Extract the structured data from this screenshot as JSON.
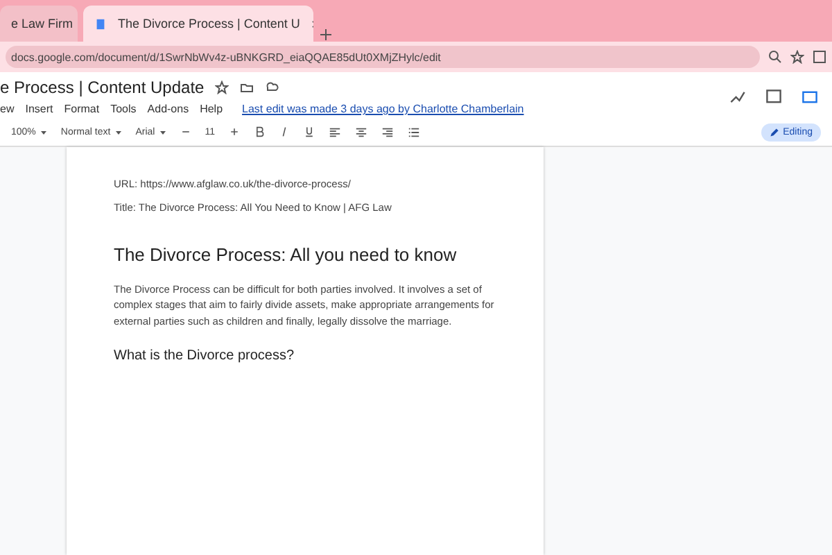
{
  "browser": {
    "tabs": [
      {
        "title": "e Law Firm",
        "selected": false
      },
      {
        "title": "The Divorce Process | Content U",
        "selected": true
      }
    ],
    "address": "docs.google.com/document/d/1SwrNbWv4z-uBNKGRD_eiaQQAE85dUt0XMjZHylc/edit"
  },
  "document_header": {
    "title": "e Process | Content Update",
    "menu": [
      "ew",
      "Insert",
      "Format",
      "Tools",
      "Add-ons",
      "Help"
    ],
    "last_edit": "Last edit was made 3 days ago by Charlotte Chamberlain"
  },
  "toolbar": {
    "zoom": "100%",
    "style": "Normal text",
    "font": "Arial",
    "font_size": "11",
    "mode": "Editing"
  },
  "page": {
    "url_line": "URL: https://www.afglaw.co.uk/the-divorce-process/",
    "title_line": "Title: The Divorce Process: All You Need to Know | AFG Law",
    "heading": "The Divorce Process: All you need to know",
    "paragraph": "The Divorce Process can be difficult for both parties involved. It involves a set of complex stages that aim to fairly divide assets, make appropriate arrangements for external parties such as children and finally, legally dissolve the marriage.",
    "subheading": "What is the Divorce process?"
  }
}
